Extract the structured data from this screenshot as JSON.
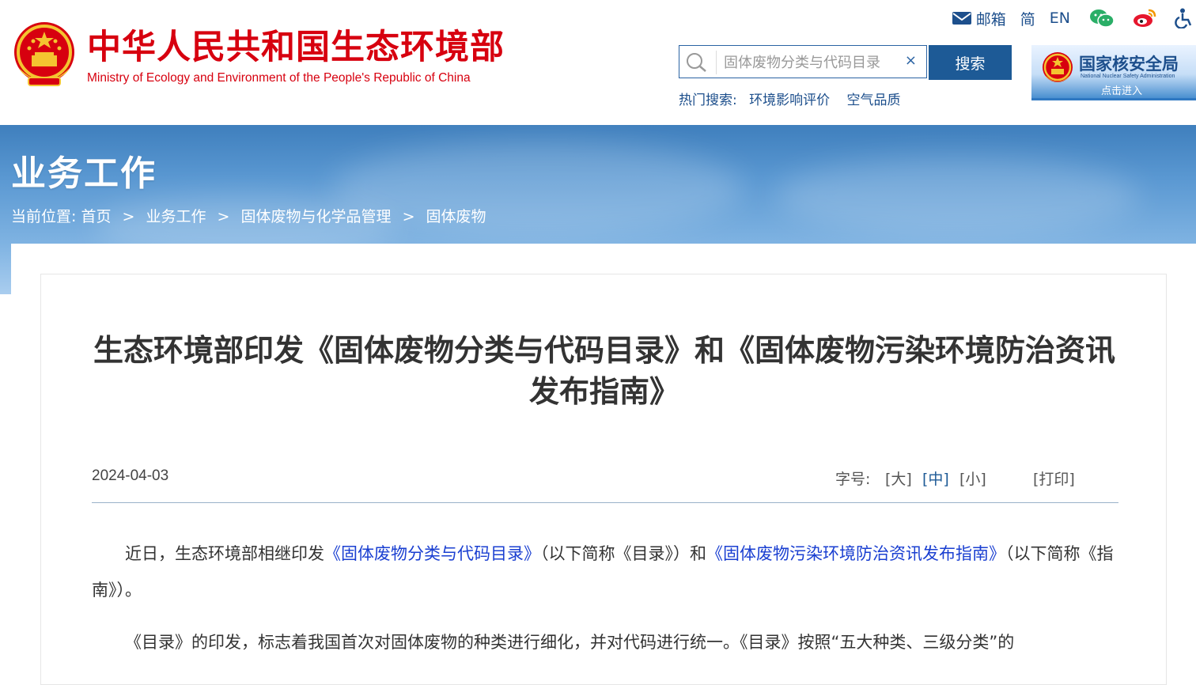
{
  "header": {
    "title": "中华人民共和国生态环境部",
    "subtitle": "Ministry of Ecology and Environment of the People's Republic of China",
    "top_links": [
      {
        "label": "邮箱",
        "icon": "mail-icon"
      },
      {
        "label": "简"
      },
      {
        "label": "EN"
      },
      {
        "label": "",
        "icon": "wechat-icon"
      },
      {
        "label": "",
        "icon": "weibo-icon"
      },
      {
        "label": "",
        "icon": "accessibility-icon"
      }
    ],
    "search": {
      "value": "固体废物分类与代码目录",
      "button_label": "搜索",
      "clear": "×"
    },
    "hot_search": {
      "label": "热门搜索:",
      "items": [
        "环境影响评价",
        "空气品质"
      ]
    },
    "nnsa_banner": {
      "title": "国家核安全局",
      "subtitle": "National Nuclear Safety Administration",
      "enter": "点击进入"
    }
  },
  "banner": {
    "section_title": "业务工作",
    "breadcrumb": {
      "prefix": "当前位置:",
      "items": [
        "首页",
        "业务工作",
        "固体废物与化学品管理",
        "固体废物"
      ],
      "separator": ">"
    }
  },
  "article": {
    "title": "生态环境部印发《固体废物分类与代码目录》和《固体废物污染环境防治资讯发布指南》",
    "date": "2024-04-03",
    "font_size": {
      "label": "字号:",
      "options": [
        "[大]",
        "[中]",
        "[小]"
      ],
      "active": "[中]"
    },
    "print_label": "[打印]",
    "paragraph1": {
      "intro": "近日，生态环境部相继印发",
      "link1": "《固体废物分类与代码目录》",
      "mid1": "（以下简称《目录》）和",
      "link2": "《固体废物污染环境防治资讯发布指南》",
      "end": "（以下简称《指南》）。"
    },
    "paragraph2": "《目录》的印发，标志着我国首次对固体废物的种类进行细化，并对代码进行统一。《目录》按照“五大种类、三级分类”的"
  },
  "colors": {
    "brand_red": "#d7000f",
    "header_blue": "#1d4f8c",
    "search_button": "#1d5a96",
    "link_blue": "#1a3fd1"
  }
}
